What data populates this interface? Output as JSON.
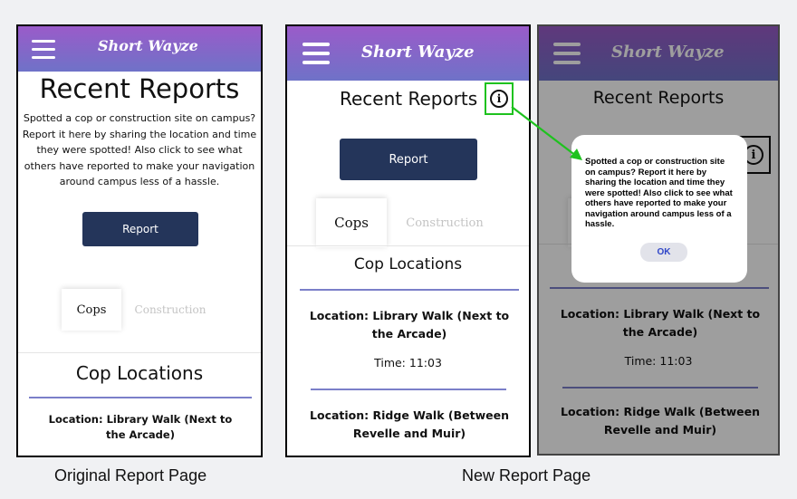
{
  "app": {
    "brand": "Short Wayze"
  },
  "shared": {
    "title": "Recent Reports",
    "report_button": "Report",
    "tab_cops": "Cops",
    "tab_construction": "Construction",
    "section_title": "Cop Locations",
    "info_icon_glyph": "i",
    "description": "Spotted a cop or construction site on campus? Report it here by sharing the location and time they were spotted! Also click to see what others have reported to make your navigation around campus less of a hassle."
  },
  "locations": [
    {
      "location": "Location: Library Walk (Next to the Arcade)",
      "time": "Time: 11:03"
    },
    {
      "location": "Location: Ridge Walk (Between Revelle and Muir)"
    }
  ],
  "modal": {
    "text": "Spotted a cop or construction site on campus? Report it here by sharing the location and time they were spotted! Also click to see what others have reported to make your navigation around campus less of a hassle.",
    "ok": "OK"
  },
  "captions": {
    "original": "Original Report Page",
    "new": "New Report Page"
  },
  "colors": {
    "header_top": "#9a5bc9",
    "header_bottom": "#6f72c8",
    "button": "#24355a",
    "divider": "#7b7fc9",
    "highlight": "#1ec21e",
    "ok_text": "#2f45c8"
  }
}
